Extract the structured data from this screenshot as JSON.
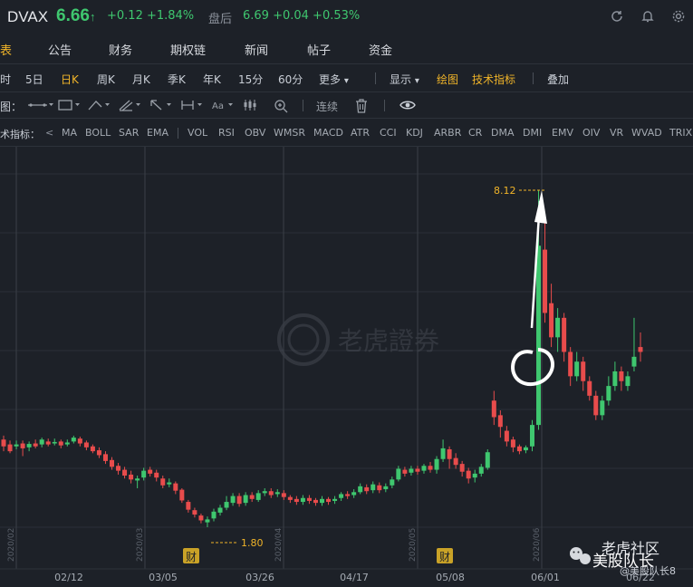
{
  "header": {
    "ticker": "DVAX",
    "price": "6.66",
    "price_arrow": "↑",
    "change": "+0.12 +1.84%",
    "afterhours_label": "盘后",
    "afterhours_value": "6.69 +0.04 +0.53%",
    "icons": [
      "refresh-icon",
      "bell-icon",
      "gear-icon"
    ]
  },
  "tabs": [
    {
      "label": "表",
      "active": true
    },
    {
      "label": "公告"
    },
    {
      "label": "财务"
    },
    {
      "label": "期权链"
    },
    {
      "label": "新闻"
    },
    {
      "label": "帖子"
    },
    {
      "label": "资金"
    }
  ],
  "periods": {
    "items": [
      "时",
      "5日",
      "日K",
      "周K",
      "月K",
      "季K",
      "年K",
      "15分",
      "60分",
      "更多"
    ],
    "active": "日K",
    "more_arrow": "▾",
    "display": "显示",
    "draw": "绘图",
    "tech": "技术指标",
    "overlay": "叠加"
  },
  "drawbar": {
    "label": "图：",
    "continuous": "连续"
  },
  "indicators": {
    "label": "术指标：",
    "prev": "<",
    "items": [
      "MA",
      "BOLL",
      "SAR",
      "EMA",
      "VOL",
      "RSI",
      "OBV",
      "WMSR",
      "MACD",
      "ATR",
      "CCI",
      "KDJ",
      "ARBR",
      "CR",
      "DMA",
      "DMI",
      "EMV",
      "OIV",
      "VR",
      "WVAD",
      "TRIX"
    ]
  },
  "chart_data": {
    "type": "candlestick",
    "x_labels": [
      "02/12",
      "03/05",
      "03/26",
      "04/17",
      "05/08",
      "06/01",
      "06/22"
    ],
    "month_markers": [
      "2020/02",
      "2020/03",
      "2020/04",
      "2020/05",
      "2020/06"
    ],
    "high_label": "8.12",
    "low_label": "1.80",
    "event_badge": "财",
    "watermark": "老虎證券",
    "up_color": "#3fc76f",
    "down_color": "#e84c4c",
    "high_color": "#f0b429",
    "candles": [
      {
        "o": 3.0,
        "c": 2.86,
        "h": 3.08,
        "l": 2.76
      },
      {
        "o": 2.9,
        "c": 2.76,
        "h": 2.98,
        "l": 2.72
      },
      {
        "o": 2.86,
        "c": 2.9,
        "h": 2.98,
        "l": 2.8
      },
      {
        "o": 2.92,
        "c": 2.82,
        "h": 2.98,
        "l": 2.66
      },
      {
        "o": 2.84,
        "c": 2.91,
        "h": 2.96,
        "l": 2.76
      },
      {
        "o": 2.92,
        "c": 2.86,
        "h": 3.0,
        "l": 2.82
      },
      {
        "o": 2.9,
        "c": 3.0,
        "h": 3.04,
        "l": 2.84
      },
      {
        "o": 2.96,
        "c": 2.9,
        "h": 3.02,
        "l": 2.86
      },
      {
        "o": 2.92,
        "c": 2.95,
        "h": 3.02,
        "l": 2.88
      },
      {
        "o": 2.96,
        "c": 2.88,
        "h": 3.0,
        "l": 2.82
      },
      {
        "o": 2.9,
        "c": 2.94,
        "h": 3.0,
        "l": 2.86
      },
      {
        "o": 2.96,
        "c": 3.04,
        "h": 3.08,
        "l": 2.92
      },
      {
        "o": 3.02,
        "c": 2.92,
        "h": 3.06,
        "l": 2.86
      },
      {
        "o": 2.94,
        "c": 2.84,
        "h": 2.98,
        "l": 2.78
      },
      {
        "o": 2.86,
        "c": 2.76,
        "h": 2.9,
        "l": 2.72
      },
      {
        "o": 2.78,
        "c": 2.68,
        "h": 2.84,
        "l": 2.62
      },
      {
        "o": 2.7,
        "c": 2.56,
        "h": 2.76,
        "l": 2.5
      },
      {
        "o": 2.58,
        "c": 2.44,
        "h": 2.64,
        "l": 2.38
      },
      {
        "o": 2.46,
        "c": 2.36,
        "h": 2.52,
        "l": 2.28
      },
      {
        "o": 2.38,
        "c": 2.26,
        "h": 2.44,
        "l": 2.2
      },
      {
        "o": 2.28,
        "c": 2.18,
        "h": 2.36,
        "l": 2.1
      },
      {
        "o": 2.16,
        "c": 2.2,
        "h": 2.26,
        "l": 2.0
      },
      {
        "o": 2.22,
        "c": 2.36,
        "h": 2.42,
        "l": 2.16
      },
      {
        "o": 2.38,
        "c": 2.3,
        "h": 2.44,
        "l": 2.24
      },
      {
        "o": 2.32,
        "c": 2.22,
        "h": 2.38,
        "l": 2.14
      },
      {
        "o": 2.2,
        "c": 2.06,
        "h": 2.26,
        "l": 2.0
      },
      {
        "o": 2.08,
        "c": 2.12,
        "h": 2.2,
        "l": 2.02
      },
      {
        "o": 2.1,
        "c": 1.95,
        "h": 2.14,
        "l": 1.88
      },
      {
        "o": 1.97,
        "c": 1.75,
        "h": 2.0,
        "l": 1.7
      },
      {
        "o": 1.72,
        "c": 1.56,
        "h": 1.76,
        "l": 1.5
      },
      {
        "o": 1.55,
        "c": 1.46,
        "h": 1.6,
        "l": 1.4
      },
      {
        "o": 1.44,
        "c": 1.34,
        "h": 1.48,
        "l": 1.28
      },
      {
        "o": 1.3,
        "c": 1.36,
        "h": 1.42,
        "l": 1.2
      },
      {
        "o": 1.38,
        "c": 1.52,
        "h": 1.58,
        "l": 1.32
      },
      {
        "o": 1.5,
        "c": 1.6,
        "h": 1.66,
        "l": 1.44
      },
      {
        "o": 1.6,
        "c": 1.72,
        "h": 1.84,
        "l": 1.55
      },
      {
        "o": 1.7,
        "c": 1.84,
        "h": 1.9,
        "l": 1.64
      },
      {
        "o": 1.84,
        "c": 1.68,
        "h": 1.9,
        "l": 1.62
      },
      {
        "o": 1.7,
        "c": 1.86,
        "h": 1.92,
        "l": 1.64
      },
      {
        "o": 1.86,
        "c": 1.78,
        "h": 1.92,
        "l": 1.72
      },
      {
        "o": 1.76,
        "c": 1.9,
        "h": 1.96,
        "l": 1.72
      },
      {
        "o": 1.9,
        "c": 1.94,
        "h": 2.0,
        "l": 1.84
      },
      {
        "o": 1.94,
        "c": 1.86,
        "h": 2.0,
        "l": 1.8
      },
      {
        "o": 1.88,
        "c": 1.92,
        "h": 1.98,
        "l": 1.82
      },
      {
        "o": 1.9,
        "c": 1.82,
        "h": 1.96,
        "l": 1.76
      },
      {
        "o": 1.82,
        "c": 1.76,
        "h": 1.86,
        "l": 1.7
      },
      {
        "o": 1.78,
        "c": 1.72,
        "h": 1.84,
        "l": 1.66
      },
      {
        "o": 1.72,
        "c": 1.8,
        "h": 1.86,
        "l": 1.66
      },
      {
        "o": 1.8,
        "c": 1.74,
        "h": 1.86,
        "l": 1.68
      },
      {
        "o": 1.76,
        "c": 1.7,
        "h": 1.8,
        "l": 1.64
      },
      {
        "o": 1.7,
        "c": 1.78,
        "h": 1.84,
        "l": 1.64
      },
      {
        "o": 1.78,
        "c": 1.72,
        "h": 1.82,
        "l": 1.66
      },
      {
        "o": 1.74,
        "c": 1.78,
        "h": 1.84,
        "l": 1.68
      },
      {
        "o": 1.8,
        "c": 1.88,
        "h": 1.92,
        "l": 1.74
      },
      {
        "o": 1.88,
        "c": 1.84,
        "h": 1.94,
        "l": 1.78
      },
      {
        "o": 1.86,
        "c": 1.92,
        "h": 1.98,
        "l": 1.8
      },
      {
        "o": 1.92,
        "c": 2.04,
        "h": 2.1,
        "l": 1.88
      },
      {
        "o": 2.02,
        "c": 1.94,
        "h": 2.08,
        "l": 1.88
      },
      {
        "o": 1.96,
        "c": 2.08,
        "h": 2.14,
        "l": 1.9
      },
      {
        "o": 2.06,
        "c": 1.96,
        "h": 2.12,
        "l": 1.9
      },
      {
        "o": 1.98,
        "c": 2.04,
        "h": 2.1,
        "l": 1.92
      },
      {
        "o": 2.06,
        "c": 2.18,
        "h": 2.24,
        "l": 2.0
      },
      {
        "o": 2.18,
        "c": 2.4,
        "h": 2.46,
        "l": 2.14
      },
      {
        "o": 2.38,
        "c": 2.3,
        "h": 2.44,
        "l": 2.24
      },
      {
        "o": 2.32,
        "c": 2.4,
        "h": 2.46,
        "l": 2.26
      },
      {
        "o": 2.4,
        "c": 2.34,
        "h": 2.46,
        "l": 2.28
      },
      {
        "o": 2.36,
        "c": 2.46,
        "h": 2.5,
        "l": 2.3
      },
      {
        "o": 2.46,
        "c": 2.38,
        "h": 2.54,
        "l": 2.32
      },
      {
        "o": 2.38,
        "c": 2.6,
        "h": 2.66,
        "l": 2.3
      },
      {
        "o": 2.6,
        "c": 2.82,
        "h": 3.0,
        "l": 2.54
      },
      {
        "o": 2.8,
        "c": 2.6,
        "h": 2.86,
        "l": 2.4
      },
      {
        "o": 2.62,
        "c": 2.48,
        "h": 2.72,
        "l": 2.4
      },
      {
        "o": 2.5,
        "c": 2.34,
        "h": 2.56,
        "l": 2.24
      },
      {
        "o": 2.36,
        "c": 2.2,
        "h": 2.42,
        "l": 2.1
      },
      {
        "o": 2.22,
        "c": 2.3,
        "h": 2.38,
        "l": 2.12
      },
      {
        "o": 2.3,
        "c": 2.44,
        "h": 2.5,
        "l": 2.24
      },
      {
        "o": 2.42,
        "c": 2.74,
        "h": 2.8,
        "l": 2.38
      },
      {
        "o": 3.8,
        "c": 3.46,
        "h": 4.0,
        "l": 3.3
      },
      {
        "o": 3.5,
        "c": 3.26,
        "h": 3.6,
        "l": 3.04
      },
      {
        "o": 3.18,
        "c": 2.96,
        "h": 3.28,
        "l": 2.86
      },
      {
        "o": 3.0,
        "c": 2.84,
        "h": 3.06,
        "l": 2.74
      },
      {
        "o": 2.86,
        "c": 2.76,
        "h": 2.9,
        "l": 2.7
      },
      {
        "o": 2.78,
        "c": 2.84,
        "h": 2.88,
        "l": 2.72
      },
      {
        "o": 2.86,
        "c": 3.3,
        "h": 3.4,
        "l": 2.76
      },
      {
        "o": 3.3,
        "c": 6.98,
        "h": 8.12,
        "l": 3.2
      },
      {
        "o": 6.9,
        "c": 5.6,
        "h": 7.6,
        "l": 5.4
      },
      {
        "o": 5.8,
        "c": 5.1,
        "h": 6.2,
        "l": 4.9
      },
      {
        "o": 5.1,
        "c": 5.5,
        "h": 5.7,
        "l": 4.8
      },
      {
        "o": 5.5,
        "c": 4.8,
        "h": 5.6,
        "l": 4.6
      },
      {
        "o": 4.8,
        "c": 4.3,
        "h": 4.9,
        "l": 4.1
      },
      {
        "o": 4.3,
        "c": 4.6,
        "h": 4.8,
        "l": 4.2
      },
      {
        "o": 4.6,
        "c": 4.2,
        "h": 4.7,
        "l": 4.0
      },
      {
        "o": 4.2,
        "c": 3.9,
        "h": 4.3,
        "l": 3.8
      },
      {
        "o": 3.9,
        "c": 3.5,
        "h": 4.0,
        "l": 3.4
      },
      {
        "o": 3.5,
        "c": 3.8,
        "h": 3.9,
        "l": 3.4
      },
      {
        "o": 3.8,
        "c": 4.1,
        "h": 4.3,
        "l": 3.7
      },
      {
        "o": 4.1,
        "c": 4.4,
        "h": 4.6,
        "l": 4.0
      },
      {
        "o": 4.4,
        "c": 4.2,
        "h": 4.5,
        "l": 4.0
      },
      {
        "o": 4.1,
        "c": 4.3,
        "h": 4.4,
        "l": 4.0
      },
      {
        "o": 4.5,
        "c": 4.7,
        "h": 5.5,
        "l": 4.4
      },
      {
        "o": 4.9,
        "c": 4.8,
        "h": 5.2,
        "l": 4.6
      }
    ]
  },
  "watermark_footer": {
    "brand": "老虎社区",
    "name": "美股队长",
    "handle": "@美股队长8"
  }
}
